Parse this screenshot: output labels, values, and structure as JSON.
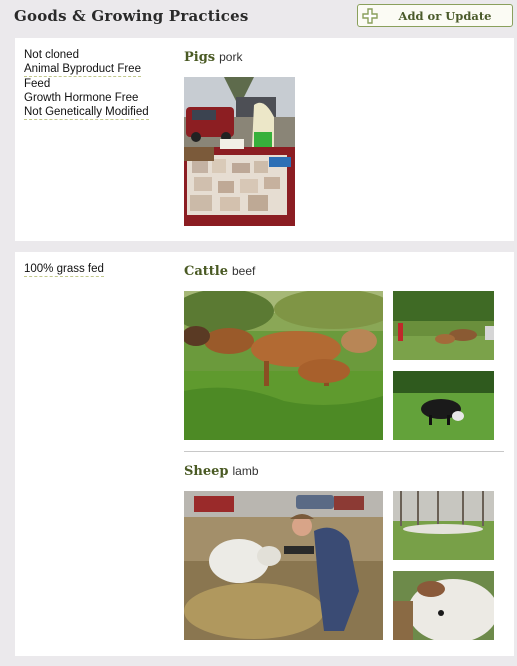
{
  "header": {
    "title": "Goods & Growing Practices",
    "add_button_label": "Add or Update",
    "add_icon": "plus-icon",
    "accent": "#8aa05c"
  },
  "sections": [
    {
      "practices": [
        "Not cloned",
        "Animal Byproduct Free",
        "Feed",
        "Growth Hormone Free",
        "Not Genetically Modified"
      ],
      "animals": [
        {
          "name": "Pigs",
          "product": "pork"
        }
      ]
    },
    {
      "practices": [
        "100% grass fed"
      ],
      "animals": [
        {
          "name": "Cattle",
          "product": "beef"
        },
        {
          "name": "Sheep",
          "product": "lamb"
        }
      ]
    }
  ]
}
